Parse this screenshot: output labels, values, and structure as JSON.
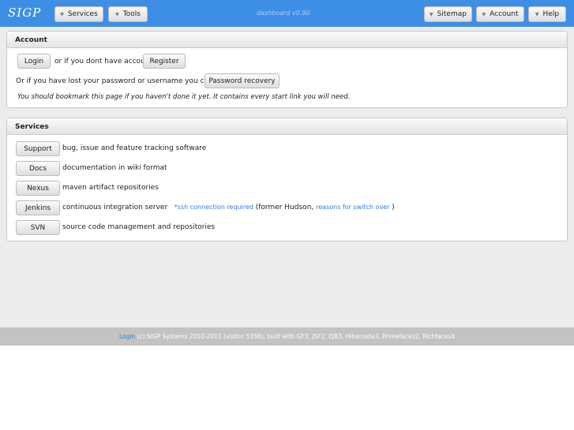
{
  "header": {
    "logo": "SIGP Systems",
    "menus": [
      {
        "label": "Services"
      },
      {
        "label": "Tools"
      }
    ],
    "version": "dashboard v0.90",
    "right_menus": [
      {
        "label": "Sitemap"
      },
      {
        "label": "Account"
      },
      {
        "label": "Help"
      }
    ]
  },
  "account": {
    "title": "Account",
    "login": "Login",
    "or_text": "or if you dont have account",
    "register": "Register",
    "lost_text": "Or if you have lost your password or username you can use",
    "recovery": "Password recovery",
    "bookmark_note": "You should bookmark this page if you haven't done it yet. It contains every start link you will need."
  },
  "services": {
    "title": "Services",
    "items": [
      {
        "label": "Support",
        "desc": "bug, issue and feature tracking software"
      },
      {
        "label": "Docs",
        "desc": "documentation in wiki format"
      },
      {
        "label": "Nexus",
        "desc": "maven artifact repositories"
      },
      {
        "label": "Jenkins",
        "desc": "continuous integration server",
        "link1": "*ssh connection required",
        "mid": "(former Hudson,",
        "link2": "reasons for switch over",
        "end": ")"
      },
      {
        "label": "SVN",
        "desc": "source code management and repositories"
      }
    ]
  },
  "footer": {
    "login": "Login",
    "text": "(c) SIGP Systems 2010-2011 (visitor 5356), built with GF3, JSF2, EJB3, Hibernate3, Primefaces2, Richfaces4"
  }
}
